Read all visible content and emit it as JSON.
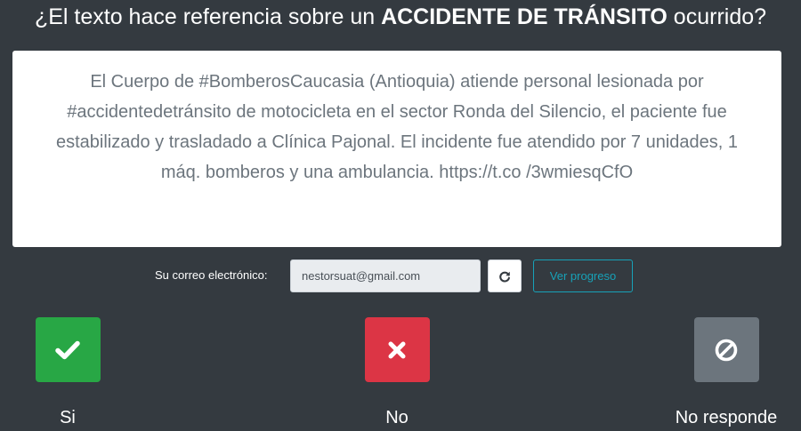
{
  "question": {
    "prefix": "¿El texto hace referencia sobre un ",
    "emphasis": "ACCIDENTE DE TRÁNSITO",
    "suffix": " ocurrido?"
  },
  "tweet": {
    "text": "El Cuerpo de #BomberosCaucasia (Antioquia) atiende personal lesionada por #accidentedetránsito de motocicleta en el sector Ronda del Silencio, el paciente fue estabilizado y trasladado a Clínica Pajonal. El incidente fue atendido por 7 unidades, 1 máq. bomberos y una ambulancia. https://t.co /3wmiesqCfO"
  },
  "email": {
    "label": "Su correo electrónico:",
    "value": "nestorsuat@gmail.com",
    "refresh_icon": "refresh-icon",
    "progress_label": "Ver progreso"
  },
  "answers": {
    "yes": {
      "label": "Si",
      "icon": "check-icon",
      "color": "#28a745"
    },
    "no": {
      "label": "No",
      "icon": "times-icon",
      "color": "#dc3545"
    },
    "no_response": {
      "label": "No responde",
      "icon": "ban-icon",
      "color": "#6c757d"
    }
  },
  "colors": {
    "background": "#343a40",
    "accent": "#17a2b8"
  }
}
